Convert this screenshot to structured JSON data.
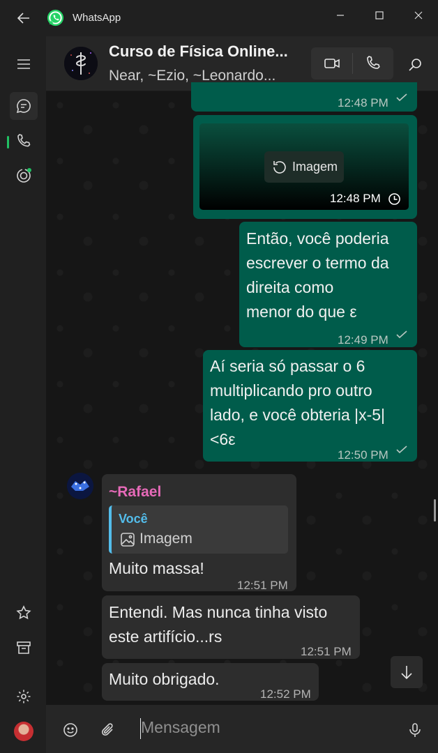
{
  "app": {
    "title": "WhatsApp"
  },
  "chat": {
    "title": "Curso de Física Online...",
    "participants": "Near, ~Ezio, ~Leonardo..."
  },
  "messages": [
    {
      "time": "12:48 PM"
    },
    {
      "image_label": "Imagem",
      "time": "12:48 PM"
    },
    {
      "lines": [
        "Então, você poderia",
        "escrever o termo da",
        "direita como",
        "menor do que ε"
      ],
      "time": "12:49 PM"
    },
    {
      "lines": [
        "Aí seria só passar o  6",
        "multiplicando pro outro",
        "lado, e você obteria |x-5|",
        "<6ε"
      ],
      "time": "12:50 PM"
    },
    {
      "sender": "~Rafael",
      "quote_author": "Você",
      "quote_text": "Imagem",
      "text": "Muito massa!",
      "time": "12:51 PM"
    },
    {
      "lines": [
        "Entendi. Mas nunca tinha visto",
        "este artifício...rs"
      ],
      "time": "12:51 PM"
    },
    {
      "text": "Muito obrigado.",
      "time": "12:52 PM"
    }
  ],
  "composer": {
    "placeholder": "Mensagem"
  },
  "colors": {
    "accent": "#21c063",
    "outgoing_bubble": "#005c4b",
    "incoming_bubble": "#2d2d2d",
    "sender_name": "#e66ab8",
    "quote_bar": "#53bdeb"
  }
}
